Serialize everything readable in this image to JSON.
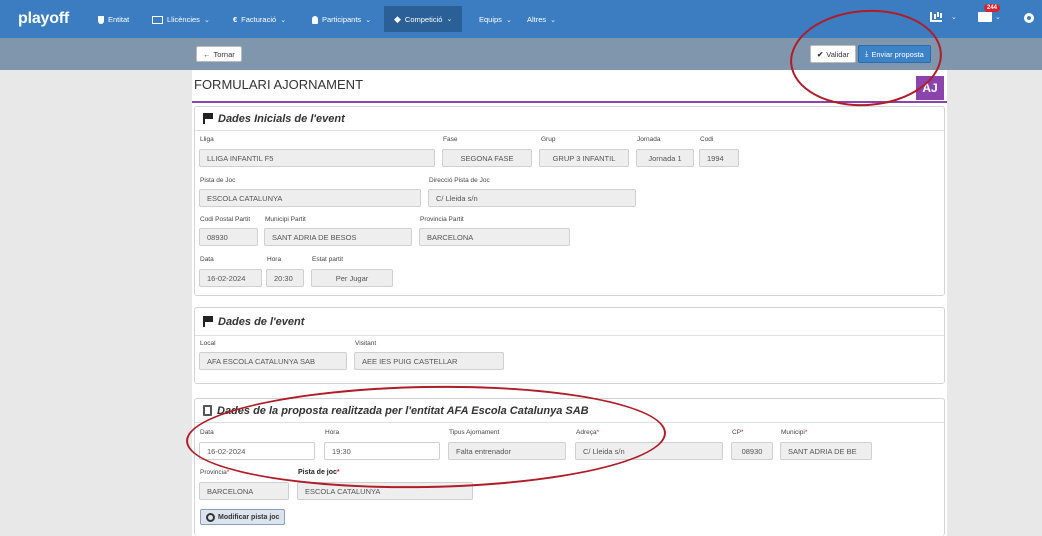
{
  "nav": {
    "brand": "playoff",
    "items": [
      {
        "label": "Entitat",
        "chevron": false
      },
      {
        "label": "Llicències",
        "chevron": true
      },
      {
        "label": "Facturació",
        "chevron": true
      },
      {
        "label": "Participants",
        "chevron": true
      },
      {
        "label": "Competició",
        "chevron": true
      },
      {
        "label": "Equips",
        "chevron": true
      },
      {
        "label": "Altres",
        "chevron": true
      }
    ],
    "chevron": "⌄",
    "mail_badge": "244"
  },
  "toolbar": {
    "back_label": "Tornar",
    "validate_label": "Validar",
    "send_label": "Enviar proposta"
  },
  "header": {
    "title": "FORMULARI AJORNAMENT",
    "badge": "AJ"
  },
  "initial": {
    "title": "Dades Inicials de l'event",
    "lliga_label": "Lliga",
    "lliga": "LLIGA INFANTIL F5",
    "fase_label": "Fase",
    "fase": "SEGONA FASE",
    "grup_label": "Grup",
    "grup": "GRUP 3 INFANTIL",
    "jornada_label": "Jornada",
    "jornada": "Jornada 1",
    "codi_label": "Codi",
    "codi": "1994",
    "pista_label": "Pista de Joc",
    "pista": "ESCOLA CATALUNYA",
    "direccio_label": "Direcció Pista de Joc",
    "direccio": "C/ Lleida s/n",
    "cp_label": "Codi Postal Partit",
    "cp": "08930",
    "municipi_label": "Municipi Partit",
    "municipi": "SANT ADRIA DE BESOS",
    "provincia_label": "Provincia Partit",
    "provincia": "BARCELONA",
    "data_label": "Data",
    "data": "16-02-2024",
    "hora_label": "Hora",
    "hora": "20:30",
    "estat_label": "Estat partit",
    "estat": "Per Jugar"
  },
  "event": {
    "title": "Dades de l'event",
    "local_label": "Local",
    "local": "AFA ESCOLA CATALUNYA SAB",
    "visitant_label": "Visitant",
    "visitant": "AEE IES PUIG CASTELLAR"
  },
  "proposal": {
    "title": "Dades de la proposta realitzada per l'entitat AFA Escola Catalunya SAB",
    "data_label": "Data",
    "data": "16-02-2024",
    "hora_label": "Hora",
    "hora": "19:30",
    "tipus_label": "Tipus Ajornament",
    "tipus": "Falta entrenador",
    "adreca_label": "Adreça",
    "adreca": "C/ Lleida s/n",
    "cp_label": "CP",
    "cp": "08930",
    "municipi_label": "Municipi",
    "municipi": "SANT ADRIA DE BE",
    "provincia_label": "Provincia",
    "provincia": "BARCELONA",
    "pista_label": "Pista de joc",
    "pista": "ESCOLA CATALUNYA",
    "required_mark": "*",
    "modify_label": "Modificar pista joc"
  },
  "colors": {
    "nav": "#3b7dc0",
    "subbar": "#7f96ad",
    "accent_purple": "#8b44ac",
    "primary_button": "#3b82c6",
    "annotation": "#b01c28"
  }
}
